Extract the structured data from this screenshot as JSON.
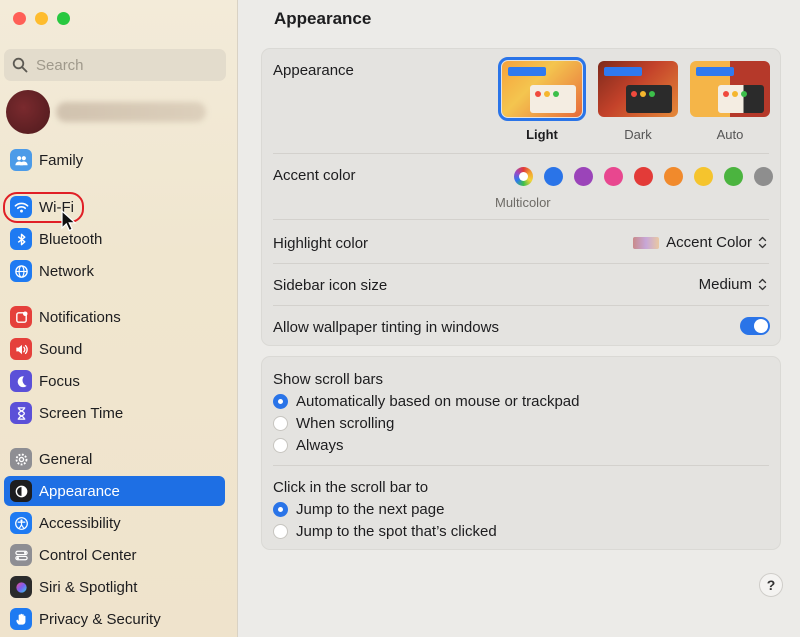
{
  "window": {
    "controls": [
      "close",
      "minimize",
      "zoom"
    ]
  },
  "search": {
    "placeholder": "Search",
    "icon": "magnifier-icon"
  },
  "sidebar": {
    "items": [
      {
        "label": "Family",
        "icon": "family-icon",
        "color": "#4c9be8"
      },
      {
        "label": "Wi-Fi",
        "icon": "wifi-icon",
        "color": "#1e7af2",
        "highlighted": true
      },
      {
        "label": "Bluetooth",
        "icon": "bluetooth-icon",
        "color": "#1e7af2"
      },
      {
        "label": "Network",
        "icon": "globe-icon",
        "color": "#1e7af2"
      },
      {
        "label": "Notifications",
        "icon": "bell-icon",
        "color": "#e5403b"
      },
      {
        "label": "Sound",
        "icon": "speaker-icon",
        "color": "#e5403b"
      },
      {
        "label": "Focus",
        "icon": "moon-icon",
        "color": "#5b50d8"
      },
      {
        "label": "Screen Time",
        "icon": "hourglass-icon",
        "color": "#5b50d8"
      },
      {
        "label": "General",
        "icon": "gear-icon",
        "color": "#8e8e93"
      },
      {
        "label": "Appearance",
        "icon": "appearance-icon",
        "color": "#1d1d1f",
        "selected": true
      },
      {
        "label": "Accessibility",
        "icon": "accessibility-icon",
        "color": "#1e7af2"
      },
      {
        "label": "Control Center",
        "icon": "control-center-icon",
        "color": "#8e8e93"
      },
      {
        "label": "Siri & Spotlight",
        "icon": "siri-icon",
        "color": "#2b2b2b"
      },
      {
        "label": "Privacy & Security",
        "icon": "hand-icon",
        "color": "#1e7af2"
      }
    ]
  },
  "main": {
    "title": "Appearance",
    "appearance": {
      "label": "Appearance",
      "options": [
        {
          "label": "Light",
          "selected": true
        },
        {
          "label": "Dark",
          "selected": false
        },
        {
          "label": "Auto",
          "selected": false
        }
      ]
    },
    "accent": {
      "label": "Accent color",
      "selected_label": "Multicolor",
      "colors": [
        "multicolor",
        "#2a74e8",
        "#9b44b9",
        "#e8478f",
        "#e33b38",
        "#f18a2c",
        "#f5c42d",
        "#4bb43f",
        "#8e8e8e"
      ]
    },
    "highlight": {
      "label": "Highlight color",
      "value": "Accent Color"
    },
    "sidebar_icon_size": {
      "label": "Sidebar icon size",
      "value": "Medium"
    },
    "wallpaper_tinting": {
      "label": "Allow wallpaper tinting in windows",
      "on": true
    },
    "scroll_bars": {
      "label": "Show scroll bars",
      "options": [
        {
          "label": "Automatically based on mouse or trackpad",
          "selected": true
        },
        {
          "label": "When scrolling",
          "selected": false
        },
        {
          "label": "Always",
          "selected": false
        }
      ]
    },
    "click_scroll": {
      "label": "Click in the scroll bar to",
      "options": [
        {
          "label": "Jump to the next page",
          "selected": true
        },
        {
          "label": "Jump to the spot that’s clicked",
          "selected": false
        }
      ]
    },
    "help": "?"
  }
}
